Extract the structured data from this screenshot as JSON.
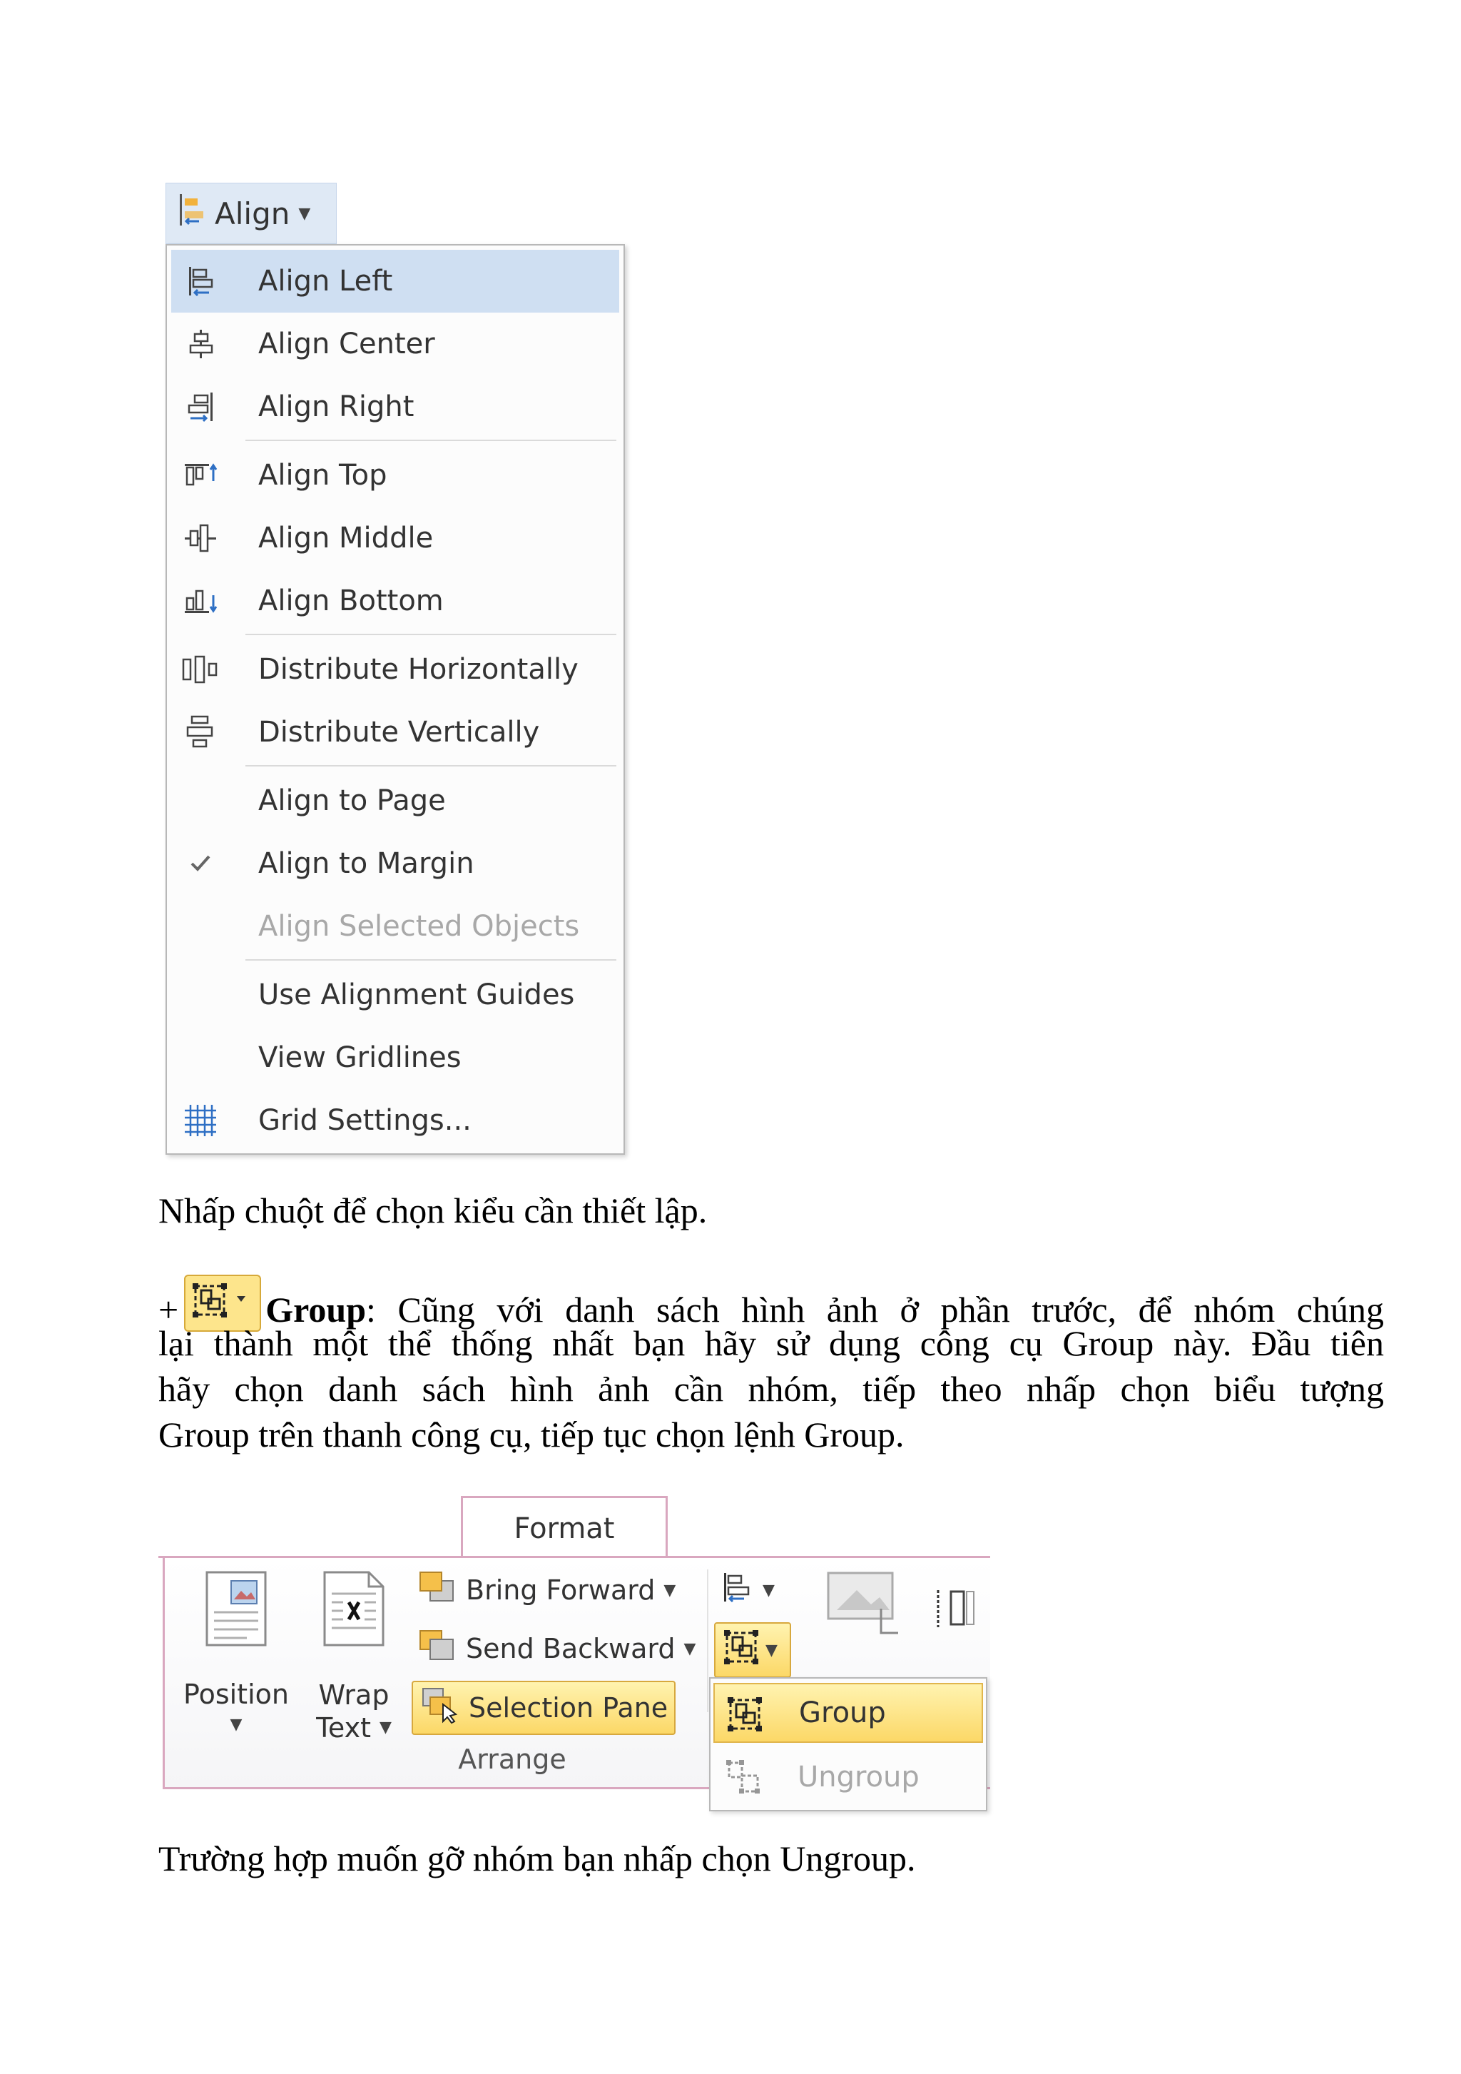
{
  "align_menu": {
    "button_label": "Align",
    "items": [
      {
        "label": "Align Left",
        "icon": "align-left-icon"
      },
      {
        "label": "Align Center",
        "icon": "align-center-icon"
      },
      {
        "label": "Align Right",
        "icon": "align-right-icon"
      },
      {
        "label": "Align Top",
        "icon": "align-top-icon"
      },
      {
        "label": "Align Middle",
        "icon": "align-middle-icon"
      },
      {
        "label": "Align Bottom",
        "icon": "align-bottom-icon"
      },
      {
        "label": "Distribute Horizontally",
        "icon": "distribute-horizontally-icon"
      },
      {
        "label": "Distribute Vertically",
        "icon": "distribute-vertically-icon"
      },
      {
        "label": "Align to Page",
        "icon": ""
      },
      {
        "label": "Align to Margin",
        "icon": "checkmark-icon"
      },
      {
        "label": "Align Selected Objects",
        "icon": ""
      },
      {
        "label": "Use Alignment Guides",
        "icon": ""
      },
      {
        "label": "View Gridlines",
        "icon": ""
      },
      {
        "label": "Grid Settings...",
        "icon": "grid-icon"
      }
    ],
    "highlighted_item": "Align Left",
    "checked_item": "Align to Margin",
    "disabled_item": "Align Selected Objects"
  },
  "text": {
    "caption1": "Nhấp chuột để chọn kiểu cần thiết lập.",
    "plus": "+",
    "group_term": "Group",
    "line1_rest": ": Cũng với danh sách hình ảnh ở phần trước, để nhóm chúng",
    "line2": "lại thành một thể thống nhất bạn hãy sử dụng công cụ Group này. Đầu tiên",
    "line3": "hãy chọn danh sách hình ảnh cần nhóm, tiếp theo nhấp chọn biểu tượng",
    "line4": "Group trên thanh công cụ, tiếp tục chọn lệnh Group.",
    "caption2": "Trường hợp muốn gỡ nhóm bạn nhấp chọn Ungroup."
  },
  "ribbon": {
    "tab_label": "Format",
    "position_label": "Position",
    "wrap_label_1": "Wrap",
    "wrap_label_2": "Text",
    "bring_forward": "Bring Forward",
    "send_backward": "Send Backward",
    "selection_pane": "Selection Pane",
    "group_name": "Arrange",
    "menu_group": "Group",
    "menu_ungroup": "Ungroup"
  },
  "colors": {
    "menu_highlight": "#cfdff2",
    "ribbon_accent": "#d9a7bf",
    "hover_yellow": "#fcd867"
  }
}
